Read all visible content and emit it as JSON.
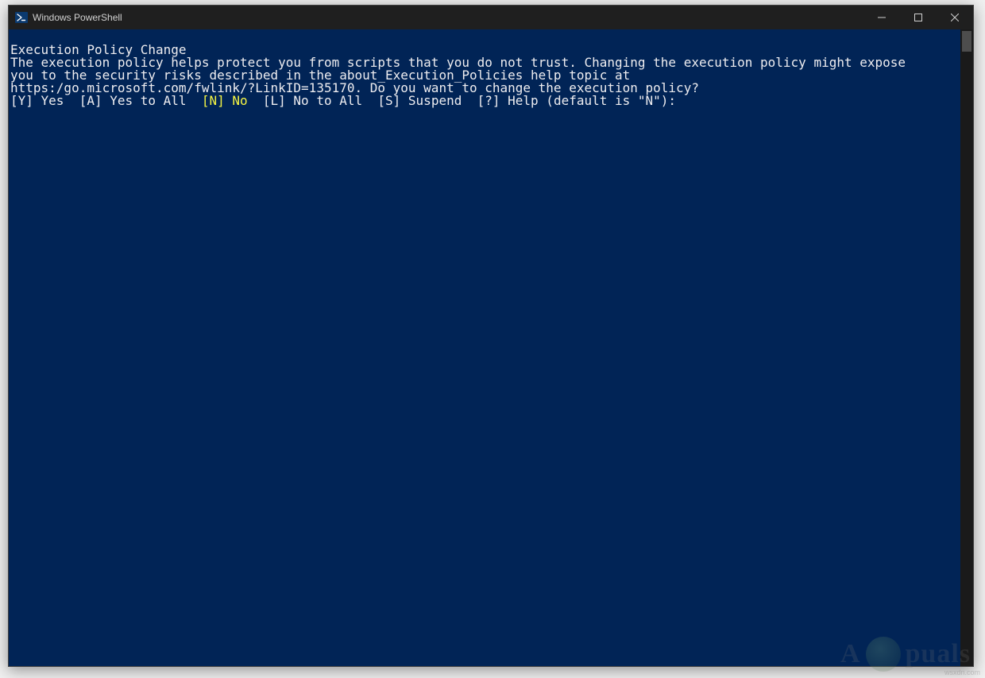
{
  "window": {
    "title": "Windows PowerShell"
  },
  "terminal": {
    "heading": "Execution Policy Change",
    "body_line1": "The execution policy helps protect you from scripts that you do not trust. Changing the execution policy might expose",
    "body_line2": "you to the security risks described in the about_Execution_Policies help topic at",
    "body_line3": "https:/go.microsoft.com/fwlink/?LinkID=135170. Do you want to change the execution policy?",
    "prompt_pre": "[Y] Yes  [A] Yes to All  ",
    "prompt_highlight": "[N] No",
    "prompt_post": "  [L] No to All  [S] Suspend  [?] Help (default is \"N\"):"
  },
  "watermark": {
    "text": "A  puals"
  },
  "source": "wsxdn.com"
}
